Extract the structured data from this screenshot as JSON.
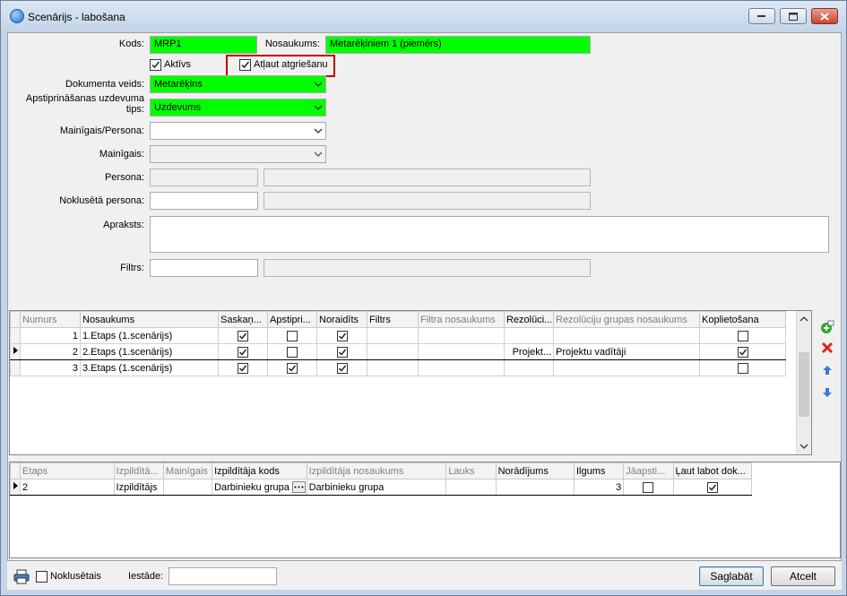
{
  "window": {
    "title": "Scenārijs - labošana"
  },
  "form": {
    "kods_label": "Kods:",
    "kods_value": "MRP1",
    "nosaukums_label": "Nosaukums:",
    "nosaukums_value": "Metarēķiniem 1 (piemērs)",
    "aktivs_label": "Aktīvs",
    "atlaut_label": "Atļaut atgriešanu",
    "dok_veids_label": "Dokumenta veids:",
    "dok_veids_value": "Metarēķins",
    "apstipr_label_1": "Apstiprināšanas uzdevuma",
    "apstipr_label_2": "tips:",
    "apstipr_value": "Uzdevums",
    "mainigais_persona_label": "Mainīgais/Persona:",
    "mainigais_label": "Mainīgais:",
    "persona_label": "Persona:",
    "nokl_persona_label": "Noklusētā persona:",
    "apraksts_label": "Apraksts:",
    "filtrs_label": "Filtrs:"
  },
  "grid1": {
    "columns": [
      "Numurs",
      "Nosaukums",
      "Saskaņ...",
      "Apstipri...",
      "Noraidīts",
      "Filtrs",
      "Filtra nosaukums",
      "Rezolūci...",
      "Rezolūciju grupas nosaukums",
      "Koplietošana"
    ],
    "rows": [
      {
        "num": "1",
        "name": "1.Etaps (1.scenārijs)",
        "sask": true,
        "apst": false,
        "nor": true,
        "filtrs": "",
        "fnos": "",
        "rez": "",
        "rezgr": "",
        "kopl": false
      },
      {
        "num": "2",
        "name": "2.Etaps (1.scenārijs)",
        "sask": true,
        "apst": false,
        "nor": true,
        "filtrs": "",
        "fnos": "",
        "rez": "Projekt...",
        "rezgr": "Projektu vadītāji",
        "kopl": true
      },
      {
        "num": "3",
        "name": "3.Etaps (1.scenārijs)",
        "sask": true,
        "apst": true,
        "nor": true,
        "filtrs": "",
        "fnos": "",
        "rez": "",
        "rezgr": "",
        "kopl": false
      }
    ]
  },
  "grid2": {
    "columns": [
      "Etaps",
      "Izpildītā...",
      "Mainīgais",
      "Izpildītāja kods",
      "Izpildītāja nosaukums",
      "Lauks",
      "Norādījums",
      "Ilgums",
      "Jāapsti...",
      "Ļaut labot dok..."
    ],
    "rows": [
      {
        "etaps": "2",
        "izp": "Izpildītājs",
        "main": "",
        "kods": "Darbinieku grupa",
        "nos": "Darbinieku grupa",
        "lauks": "",
        "nor": "",
        "ilgums": "3",
        "jaap": false,
        "laut": true
      }
    ]
  },
  "bottom": {
    "nokluset_label": "Noklusētais",
    "iestade_label": "Iestāde:",
    "save_label": "Saglabāt",
    "cancel_label": "Atcelt"
  }
}
